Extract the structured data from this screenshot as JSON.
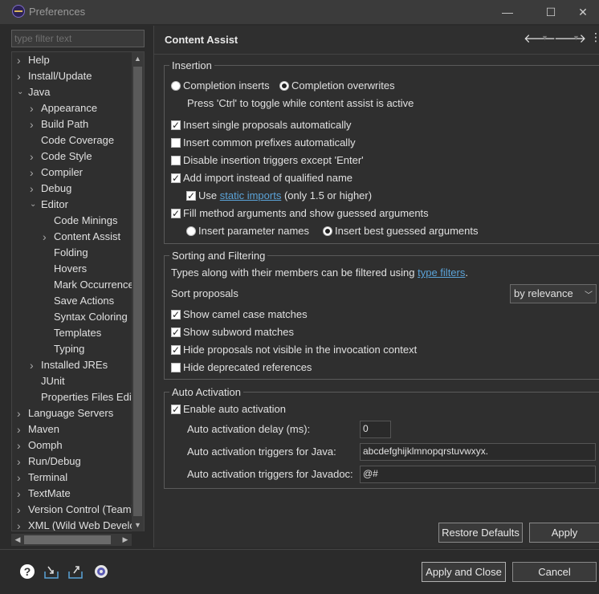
{
  "window": {
    "title": "Preferences"
  },
  "filter": {
    "placeholder": "type filter text"
  },
  "tree": [
    {
      "label": "Help",
      "level": 0,
      "twisty": "collapsed"
    },
    {
      "label": "Install/Update",
      "level": 0,
      "twisty": "collapsed"
    },
    {
      "label": "Java",
      "level": 0,
      "twisty": "expanded"
    },
    {
      "label": "Appearance",
      "level": 1,
      "twisty": "collapsed"
    },
    {
      "label": "Build Path",
      "level": 1,
      "twisty": "collapsed"
    },
    {
      "label": "Code Coverage",
      "level": 1,
      "twisty": "none"
    },
    {
      "label": "Code Style",
      "level": 1,
      "twisty": "collapsed"
    },
    {
      "label": "Compiler",
      "level": 1,
      "twisty": "collapsed"
    },
    {
      "label": "Debug",
      "level": 1,
      "twisty": "collapsed"
    },
    {
      "label": "Editor",
      "level": 1,
      "twisty": "expanded"
    },
    {
      "label": "Code Minings",
      "level": 2,
      "twisty": "none"
    },
    {
      "label": "Content Assist",
      "level": 2,
      "twisty": "collapsed"
    },
    {
      "label": "Folding",
      "level": 2,
      "twisty": "none"
    },
    {
      "label": "Hovers",
      "level": 2,
      "twisty": "none"
    },
    {
      "label": "Mark Occurrences",
      "level": 2,
      "twisty": "none"
    },
    {
      "label": "Save Actions",
      "level": 2,
      "twisty": "none"
    },
    {
      "label": "Syntax Coloring",
      "level": 2,
      "twisty": "none"
    },
    {
      "label": "Templates",
      "level": 2,
      "twisty": "none"
    },
    {
      "label": "Typing",
      "level": 2,
      "twisty": "none"
    },
    {
      "label": "Installed JREs",
      "level": 1,
      "twisty": "collapsed"
    },
    {
      "label": "JUnit",
      "level": 1,
      "twisty": "none"
    },
    {
      "label": "Properties Files Editor",
      "level": 1,
      "twisty": "none"
    },
    {
      "label": "Language Servers",
      "level": 0,
      "twisty": "collapsed"
    },
    {
      "label": "Maven",
      "level": 0,
      "twisty": "collapsed"
    },
    {
      "label": "Oomph",
      "level": 0,
      "twisty": "collapsed"
    },
    {
      "label": "Run/Debug",
      "level": 0,
      "twisty": "collapsed"
    },
    {
      "label": "Terminal",
      "level": 0,
      "twisty": "collapsed"
    },
    {
      "label": "TextMate",
      "level": 0,
      "twisty": "collapsed"
    },
    {
      "label": "Version Control (Team)",
      "level": 0,
      "twisty": "collapsed"
    },
    {
      "label": "XML (Wild Web Developer)",
      "level": 0,
      "twisty": "collapsed"
    }
  ],
  "page": {
    "title": "Content Assist",
    "insertion": {
      "legend": "Insertion",
      "completion_inserts": "Completion inserts",
      "completion_overwrites": "Completion overwrites",
      "toggle_hint": "Press 'Ctrl' to toggle while content assist is active",
      "insert_single": "Insert single proposals automatically",
      "insert_common": "Insert common prefixes automatically",
      "disable_triggers": "Disable insertion triggers except 'Enter'",
      "add_import": "Add import instead of qualified name",
      "use_label": "Use",
      "static_imports": "static imports",
      "only_15": "(only 1.5 or higher)",
      "fill_args": "Fill method arguments and show guessed arguments",
      "insert_param_names": "Insert parameter names",
      "insert_best_guessed": "Insert best guessed arguments"
    },
    "sorting": {
      "legend": "Sorting and Filtering",
      "desc_prefix": "Types along with their members can be filtered using",
      "type_filters": "type filters",
      "desc_suffix": ".",
      "sort_label": "Sort proposals",
      "sort_value": "by relevance",
      "camel": "Show camel case matches",
      "subword": "Show subword matches",
      "hide_invisible": "Hide proposals not visible in the invocation context",
      "hide_deprecated": "Hide deprecated references"
    },
    "auto": {
      "legend": "Auto Activation",
      "enable": "Enable auto activation",
      "delay_label": "Auto activation delay (ms):",
      "delay_value": "0",
      "java_label": "Auto activation triggers for Java:",
      "java_value": "abcdefghijklmnopqrstuvwxyx.",
      "javadoc_label": "Auto activation triggers for Javadoc:",
      "javadoc_value": "@#"
    },
    "restore_defaults": "Restore Defaults",
    "apply": "Apply"
  },
  "footer": {
    "apply_and_close": "Apply and Close",
    "cancel": "Cancel"
  },
  "colors": {
    "link": "#5ba3d8",
    "background": "#2f2f2f"
  }
}
